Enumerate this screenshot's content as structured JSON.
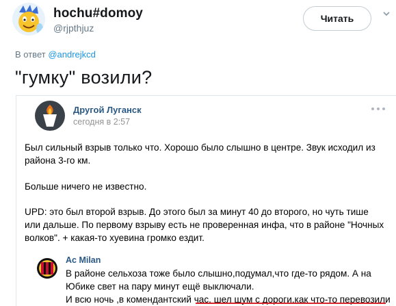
{
  "tweet": {
    "display_name": "hochu#domoy",
    "username": "@rjpthjuz",
    "follow_label": "Читать",
    "reply_prefix": "В ответ",
    "reply_handle": "@andrejkcd",
    "text": "\"гумку\" возили?"
  },
  "embedded_post": {
    "author": "Другой Луганск",
    "time": "сегодня в 2:57",
    "paragraphs": [
      "Был сильный взрыв только что. Хорошо было слышно в центре. Звук исходил из района 3-го км.",
      "Больше ничего не известно.",
      "UPD: это был второй взрыв. До этого был за минут 40 до второго, но чуть тише или дальше. По первому взрыву есть не проверенная инфа, что в районе \"Ночных волков\". + какая-то хуевина громко ездит."
    ],
    "comment": {
      "author": "Ac Milan",
      "lines": [
        "В районе сельхоза тоже было слышно,подумал,что где-то рядом. А на",
        "Юбике свет на пару минут ещё выключали.",
        "И всю ночь ,в комендантский час, шел шум с дороги,как что-то перевозили"
      ]
    }
  },
  "colors": {
    "link_blue": "#1b95e0",
    "vk_blue": "#2a5885",
    "muted": "#657786",
    "underline_red": "#d8262d"
  },
  "icons": {
    "avatar": "emoji-face-avatar",
    "caret": "chevron-down-icon",
    "vk_avatar": "torch-logo",
    "more": "more-dots-icon",
    "comment_avatar": "ac-milan-logo"
  }
}
